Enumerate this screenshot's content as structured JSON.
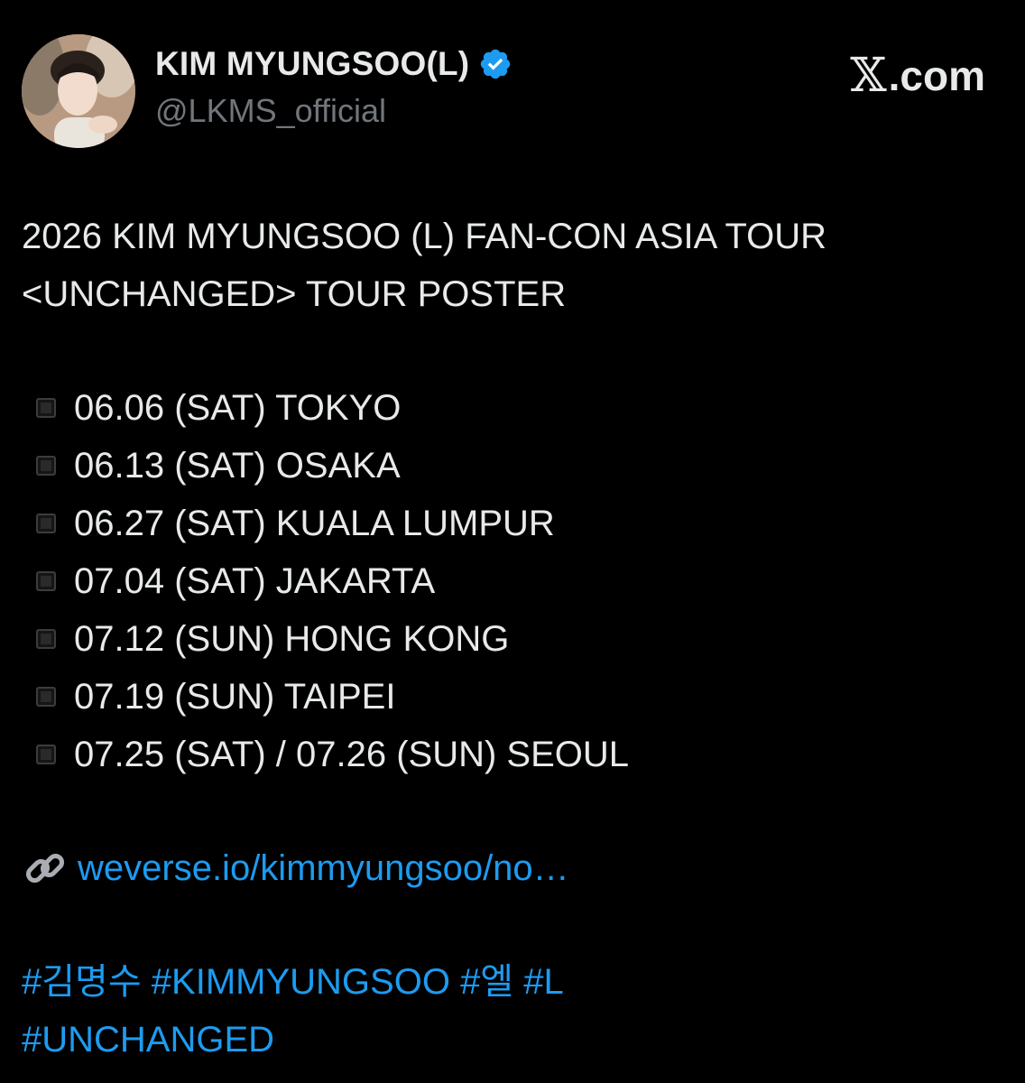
{
  "header": {
    "display_name": "KIM MYUNGSOO(L)",
    "handle": "@LKMS_official",
    "brand": ".com",
    "verified_color": "#1d9bf0"
  },
  "post": {
    "title_line1": "2026 KIM MYUNGSOO (L) FAN-CON ASIA TOUR",
    "title_line2": "<UNCHANGED> TOUR POSTER",
    "schedule": [
      "06.06 (SAT) TOKYO",
      "06.13 (SAT) OSAKA",
      "06.27 (SAT) KUALA LUMPUR",
      "07.04 (SAT) JAKARTA",
      "07.12 (SUN) HONG KONG",
      "07.19 (SUN) TAIPEI",
      "07.25 (SAT) / 07.26 (SUN) SEOUL"
    ],
    "link": "weverse.io/kimmyungsoo/no…",
    "hashtags_line1": [
      "#김명수",
      "#KIMMYUNGSOO",
      "#엘",
      "#L"
    ],
    "hashtags_line2": [
      "#UNCHANGED"
    ]
  },
  "colors": {
    "background": "#000000",
    "text": "#e7e9ea",
    "secondary": "#71767b",
    "accent": "#1d9bf0"
  }
}
